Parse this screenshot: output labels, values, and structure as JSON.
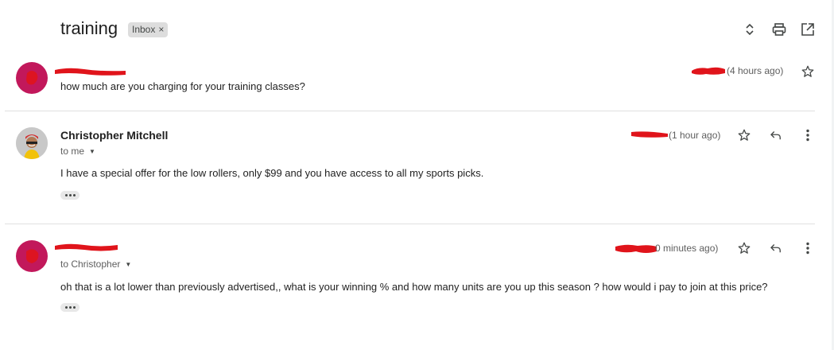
{
  "thread": {
    "subject": "training",
    "label": "Inbox",
    "label_remove": "×"
  },
  "toolbar": {
    "icons": [
      "expand-collapse-icon",
      "print-icon",
      "open-in-new-window-icon"
    ]
  },
  "messages": [
    {
      "sender": "",
      "recipient": "",
      "time": "(4 hours ago)",
      "snippet": "how much are you charging for your training classes?",
      "avatar_color": "#c2185b"
    },
    {
      "sender": "Christopher Mitchell",
      "recipient": "to me",
      "time": "(1 hour ago)",
      "body": "I have a special offer for the low rollers, only $99 and you have access to all my sports picks."
    },
    {
      "sender": "",
      "recipient": "to Christopher",
      "time": "0 minutes ago)",
      "body": "oh that is a lot lower than previously advertised,, what is your winning %  and how many units are you up this season ? how  would i pay to join at this price?",
      "avatar_color": "#c2185b"
    }
  ],
  "colors": {
    "redaction": "#e0141b",
    "chip_bg": "#dddddd",
    "divider": "#e0e0e0"
  }
}
